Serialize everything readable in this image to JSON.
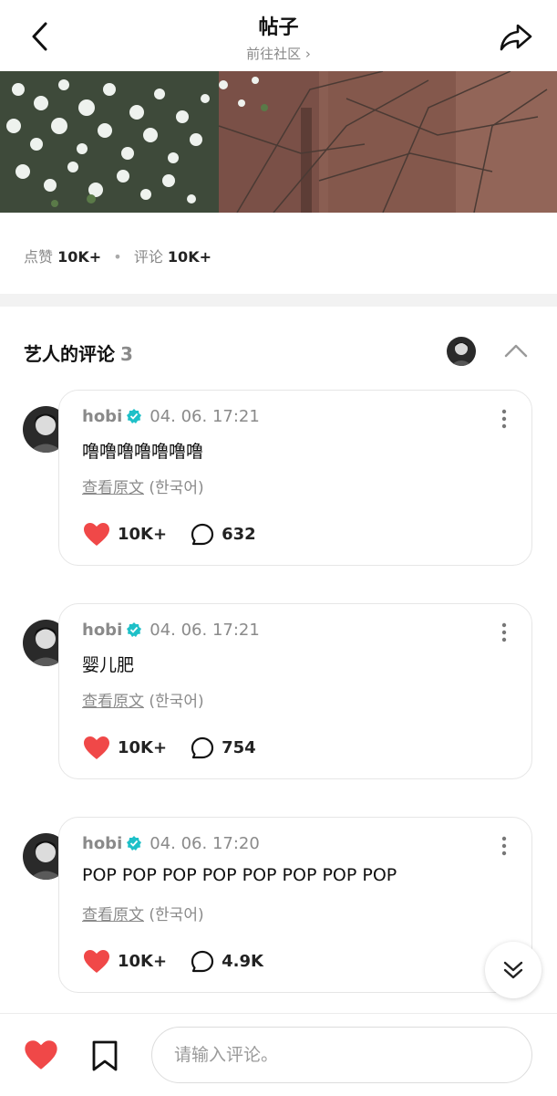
{
  "header": {
    "title": "帖子",
    "subtitle": "前往社区 ›",
    "back_icon": "chevron-left-icon",
    "share_icon": "share-arrow-icon"
  },
  "stats": {
    "likes_label": "点赞",
    "likes_value": "10K+",
    "separator": "•",
    "comments_label": "评论",
    "comments_value": "10K+"
  },
  "artist_comments": {
    "title": "艺人的评论",
    "count": "3"
  },
  "comments": [
    {
      "author": "hobi",
      "time": "04. 06. 17:21",
      "text": "噜噜噜噜噜噜噜",
      "translate_link": "查看原文",
      "translate_lang": "(한국어)",
      "likes": "10K+",
      "replies": "632"
    },
    {
      "author": "hobi",
      "time": "04. 06. 17:21",
      "text": "婴儿肥",
      "translate_link": "查看原文",
      "translate_lang": "(한국어)",
      "likes": "10K+",
      "replies": "754"
    },
    {
      "author": "hobi",
      "time": "04. 06. 17:20",
      "text": "POP POP POP POP POP POP POP POP",
      "translate_link": "查看原文",
      "translate_lang": "(한국어)",
      "likes": "10K+",
      "replies": "4.9K"
    }
  ],
  "input": {
    "placeholder": "请输入评论。"
  },
  "colors": {
    "heart": "#f04848",
    "verified": "#1ec0c8",
    "divider": "#f2f2f2"
  }
}
